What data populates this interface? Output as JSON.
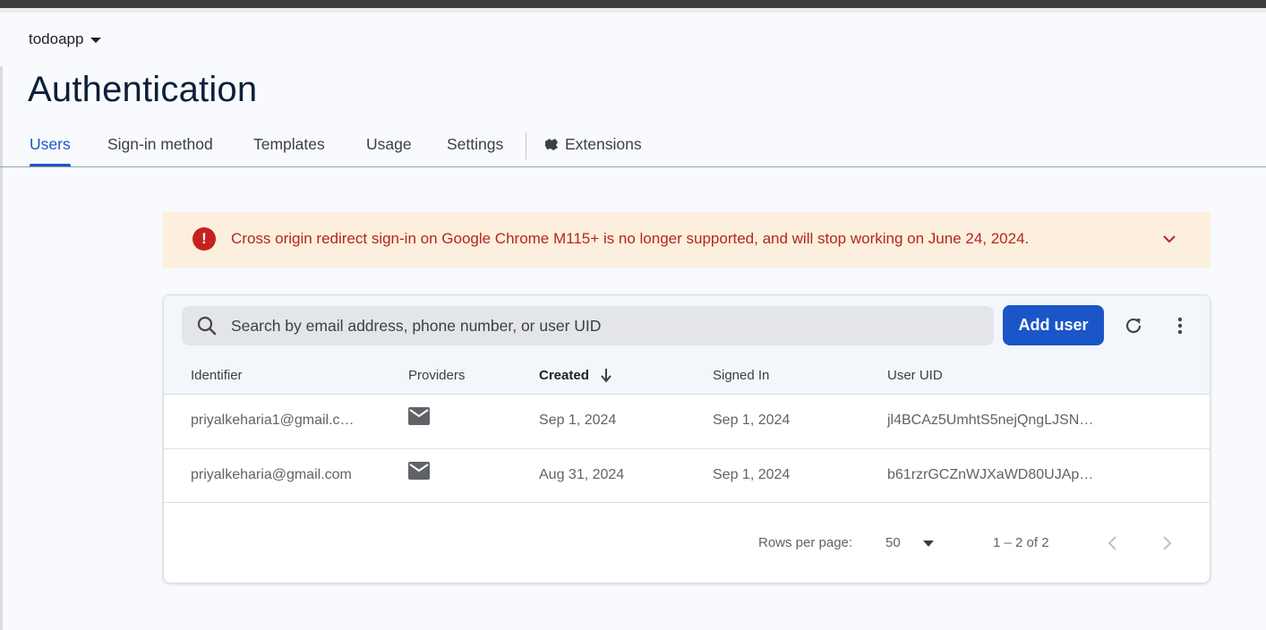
{
  "project": {
    "name": "todoapp"
  },
  "page": {
    "title": "Authentication"
  },
  "tabs": [
    {
      "label": "Users",
      "active": true
    },
    {
      "label": "Sign-in method"
    },
    {
      "label": "Templates"
    },
    {
      "label": "Usage"
    },
    {
      "label": "Settings"
    },
    {
      "label": "Extensions",
      "icon": "extensions-icon"
    }
  ],
  "banner": {
    "icon": "error-icon",
    "text": "Cross origin redirect sign-in on Google Chrome M115+ is no longer supported, and will stop working on June 24, 2024."
  },
  "toolbar": {
    "search_placeholder": "Search by email address, phone number, or user UID",
    "add_user_label": "Add user"
  },
  "table": {
    "columns": [
      "Identifier",
      "Providers",
      "Created",
      "Signed In",
      "User UID"
    ],
    "sorted_column": "Created",
    "sort_direction": "descending",
    "rows": [
      {
        "identifier": "priyalkeharia1@gmail.c…",
        "provider": "email-icon",
        "created": "Sep 1, 2024",
        "signed_in": "Sep 1, 2024",
        "uid": "jl4BCAz5UmhtS5nejQngLJSN…"
      },
      {
        "identifier": "priyalkeharia@gmail.com",
        "provider": "email-icon",
        "created": "Aug 31, 2024",
        "signed_in": "Sep 1, 2024",
        "uid": "b61rzrGCZnWJXaWD80UJAp…"
      }
    ]
  },
  "pagination": {
    "rows_per_page_label": "Rows per page:",
    "rows_per_page_value": "50",
    "range": "1 – 2 of 2"
  },
  "colors": {
    "accent": "#1a56c8",
    "title": "#0b1f3a",
    "banner_bg": "#fdefdd",
    "banner_text": "#b3261e",
    "error": "#c5221f"
  }
}
